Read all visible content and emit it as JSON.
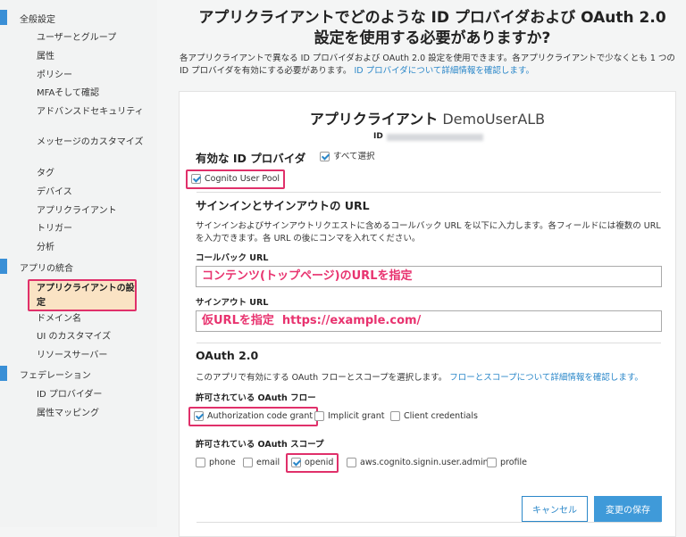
{
  "sidebar": {
    "sections": [
      {
        "label": "全般設定",
        "items": [
          "ユーザーとグループ",
          "属性",
          "ポリシー",
          "MFAそして確認",
          "アドバンスドセキュリティ",
          "メッセージのカスタマイズ",
          "タグ",
          "デバイス",
          "アプリクライアント",
          "トリガー",
          "分析"
        ]
      },
      {
        "label": "アプリの統合",
        "items": [
          "アプリクライアントの設定",
          "ドメイン名",
          "UI のカスタマイズ",
          "リソースサーバー"
        ]
      },
      {
        "label": "フェデレーション",
        "items": [
          "ID プロバイダー",
          "属性マッピング"
        ]
      }
    ],
    "active_item": "アプリクライアントの設定"
  },
  "page": {
    "title": "アプリクライアントでどのような ID プロバイダおよび OAuth 2.0 設定を使用する必要がありますか?",
    "description": "各アプリクライアントで異なる ID プロバイダおよび OAuth 2.0 設定を使用できます。各アプリクライアントで少なくとも 1 つの ID プロバイダを有効にする必要があります。",
    "description_link": "ID プロバイダについて詳細情報を確認します。"
  },
  "card": {
    "title_prefix": "アプリクライアント",
    "client_name": "DemoUserALB",
    "id_label": "ID",
    "providers_heading": "有効な ID プロバイダ",
    "select_all": "すべて選択",
    "select_all_checked": true,
    "provider": "Cognito User Pool",
    "provider_checked": true,
    "urls_heading": "サインインとサインアウトの URL",
    "urls_desc": "サインインおよびサインアウトリクエストに含めるコールバック URL を以下に入力します。各フィールドには複数の URL を入力できます。各 URL の後にコンマを入れてください。",
    "callback_label": "コールバック URL",
    "callback_value": "コンテンツ(トップページ)のURLを指定",
    "signout_label": "サインアウト URL",
    "signout_value": "仮URLを指定  https://example.com/",
    "oauth_heading": "OAuth 2.0",
    "oauth_desc": "このアプリで有効にする OAuth フローとスコープを選択します。",
    "oauth_link": "フローとスコープについて詳細情報を確認します。",
    "flows_label": "許可されている OAuth フロー",
    "flows": [
      {
        "label": "Authorization code grant",
        "checked": true
      },
      {
        "label": "Implicit grant",
        "checked": false
      },
      {
        "label": "Client credentials",
        "checked": false
      }
    ],
    "scopes_label": "許可されている OAuth スコープ",
    "scopes": [
      {
        "label": "phone",
        "checked": false
      },
      {
        "label": "email",
        "checked": false
      },
      {
        "label": "openid",
        "checked": true
      },
      {
        "label": "aws.cognito.signin.user.admin",
        "checked": false
      },
      {
        "label": "profile",
        "checked": false
      }
    ],
    "cancel": "キャンセル",
    "save": "変更の保存"
  }
}
